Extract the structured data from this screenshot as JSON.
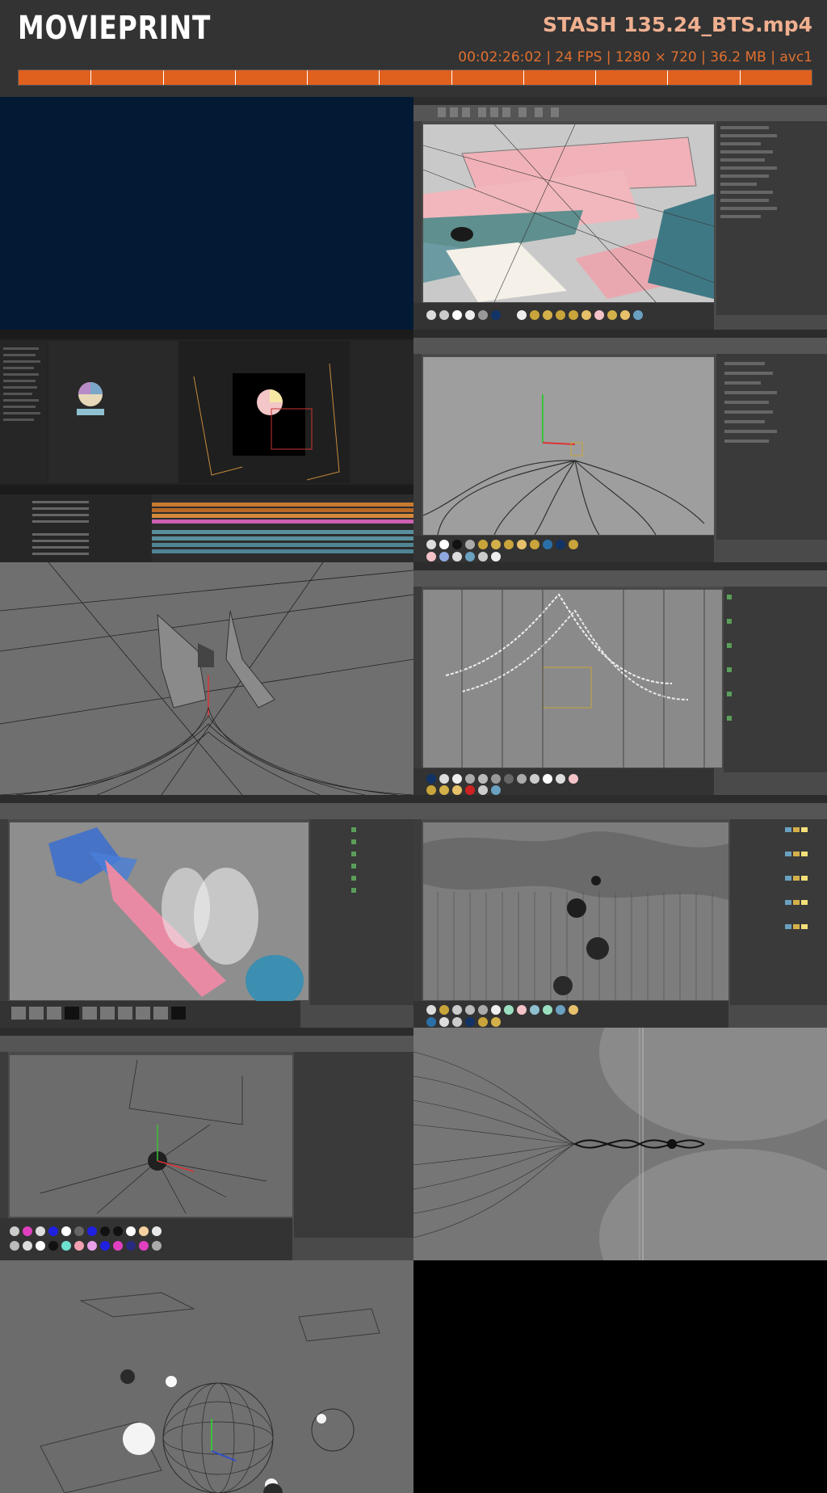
{
  "header": {
    "logo": "MOVIEPRINT",
    "filename": "STASH 135.24_BTS.mp4",
    "meta": "00:02:26:02 | 24 FPS | 1280 × 720 | 36.2 MB | avc1"
  },
  "timeline": {
    "progress_fraction": 1.0,
    "segments": 11,
    "colors": {
      "fill": "#e0601e",
      "accent_text": "#e07030",
      "title": "#f0b090"
    }
  },
  "thumbnails": [
    {
      "name": "dark-blue-frame"
    },
    {
      "name": "cinema4d-pink-panels"
    },
    {
      "name": "after-effects-comp"
    },
    {
      "name": "cinema4d-curves"
    },
    {
      "name": "wire-figures"
    },
    {
      "name": "cinema4d-ribbon"
    },
    {
      "name": "cinema4d-pink-tube"
    },
    {
      "name": "cinema4d-terrain"
    },
    {
      "name": "cinema4d-sphere-lights"
    },
    {
      "name": "wire-helix"
    },
    {
      "name": "spheres-scene"
    },
    {
      "name": "empty-frame"
    }
  ]
}
